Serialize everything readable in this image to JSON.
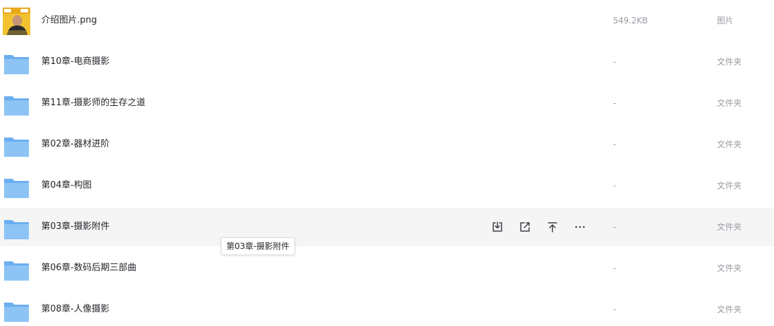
{
  "files": [
    {
      "name": "介绍图片.png",
      "size": "549.2KB",
      "type": "图片",
      "icon": "image-thumbnail-icon"
    },
    {
      "name": "第10章-电商摄影",
      "size": "-",
      "type": "文件夹",
      "icon": "folder-icon"
    },
    {
      "name": "第11章-摄影师的生存之道",
      "size": "-",
      "type": "文件夹",
      "icon": "folder-icon"
    },
    {
      "name": "第02章-器材进阶",
      "size": "-",
      "type": "文件夹",
      "icon": "folder-icon"
    },
    {
      "name": "第04章-构图",
      "size": "-",
      "type": "文件夹",
      "icon": "folder-icon"
    },
    {
      "name": "第03章-摄影附件",
      "size": "-",
      "type": "文件夹",
      "icon": "folder-icon"
    },
    {
      "name": "第06章-数码后期三部曲",
      "size": "-",
      "type": "文件夹",
      "icon": "folder-icon"
    },
    {
      "name": "第08章-人像摄影",
      "size": "-",
      "type": "文件夹",
      "icon": "folder-icon"
    }
  ],
  "hovered_row": {
    "actions": [
      {
        "icon": "download-icon"
      },
      {
        "icon": "share-icon"
      },
      {
        "icon": "move-to-top-icon"
      },
      {
        "icon": "more-icon"
      }
    ],
    "tooltip": "第03章-摄影附件"
  },
  "colors": {
    "folder": "#8dc4f5",
    "folder_dark": "#6aaef0",
    "hover_bg": "#f5f5f6",
    "text": "#25262b",
    "muted": "#9a9ca3"
  }
}
